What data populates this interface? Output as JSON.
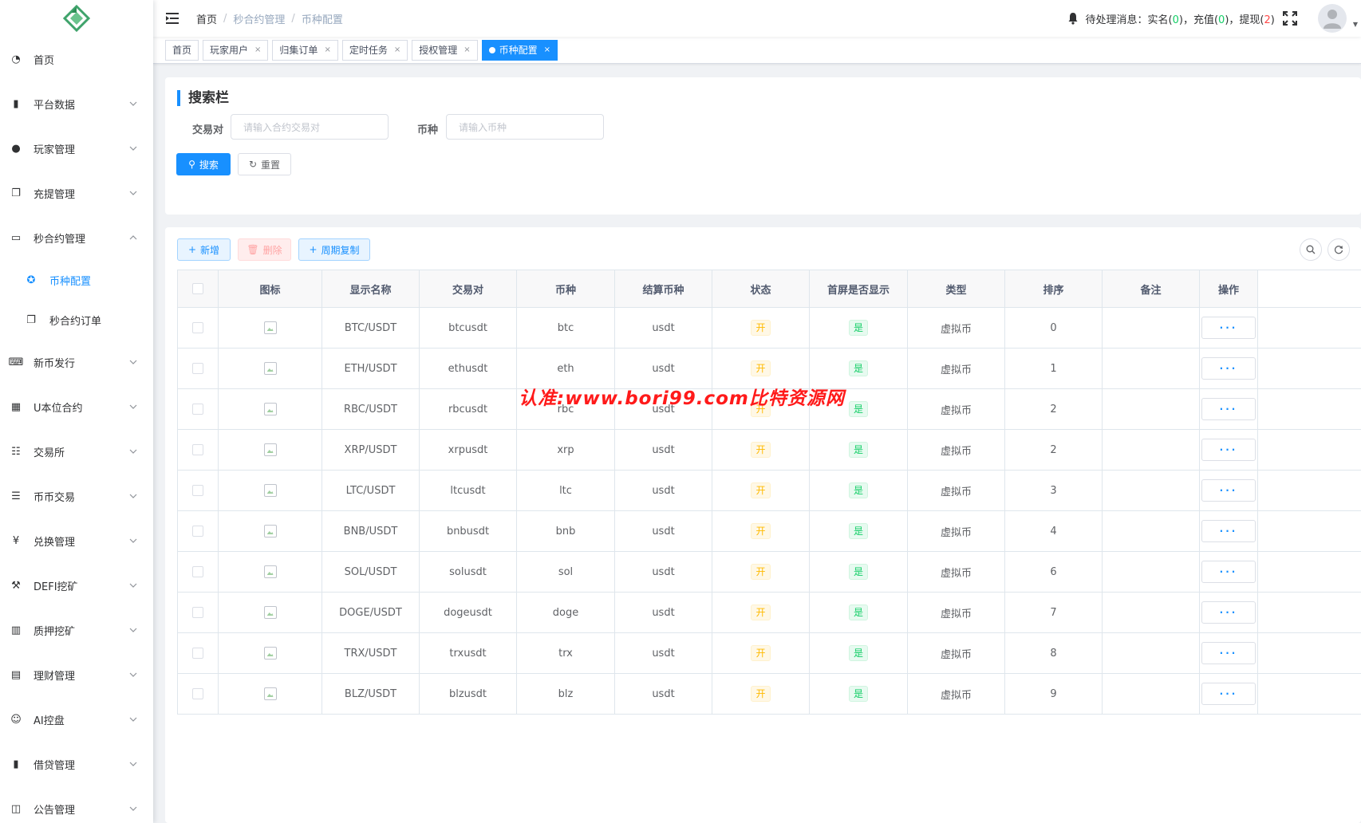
{
  "sidebar": {
    "menu": [
      {
        "label": "首页",
        "icon": "dashboard-icon",
        "arrow": ""
      },
      {
        "label": "平台数据",
        "icon": "book-icon",
        "arrow": "down"
      },
      {
        "label": "玩家管理",
        "icon": "user-icon",
        "arrow": "down"
      },
      {
        "label": "充提管理",
        "icon": "copy-icon",
        "arrow": "down"
      },
      {
        "label": "秒合约管理",
        "icon": "monitor-icon",
        "arrow": "up"
      }
    ],
    "submenu": [
      {
        "label": "币种配置",
        "icon": "gear-icon",
        "active": true
      },
      {
        "label": "秒合约订单",
        "icon": "copy-icon",
        "active": false
      }
    ],
    "menu2": [
      {
        "label": "新币发行",
        "icon": "keyboard-icon"
      },
      {
        "label": "U本位合约",
        "icon": "grid-icon"
      },
      {
        "label": "交易所",
        "icon": "tree-list-icon"
      },
      {
        "label": "币币交易",
        "icon": "list-icon"
      },
      {
        "label": "兑换管理",
        "icon": "yen-icon"
      },
      {
        "label": "DEFI挖矿",
        "icon": "shovel-icon"
      },
      {
        "label": "质押挖矿",
        "icon": "bar-chart-icon"
      },
      {
        "label": "理财管理",
        "icon": "document-icon"
      },
      {
        "label": "AI控盘",
        "icon": "robot-icon"
      },
      {
        "label": "借贷管理",
        "icon": "book-icon"
      },
      {
        "label": "公告管理",
        "icon": "open-book-icon"
      }
    ]
  },
  "navbar": {
    "breadcrumb": [
      "首页",
      "秒合约管理",
      "币种配置"
    ],
    "breadcrumb_sep": "/",
    "notice_prefix": "待处理消息：实名(",
    "notice_realname": "0",
    "notice_mid1": ")，充值(",
    "notice_recharge": "0",
    "notice_mid2": ")，提现(",
    "notice_withdraw": "2",
    "notice_suffix": ")"
  },
  "tags": [
    {
      "label": "首页",
      "closable": false,
      "active": false
    },
    {
      "label": "玩家用户",
      "closable": true,
      "active": false
    },
    {
      "label": "归集订单",
      "closable": true,
      "active": false
    },
    {
      "label": "定时任务",
      "closable": true,
      "active": false
    },
    {
      "label": "授权管理",
      "closable": true,
      "active": false
    },
    {
      "label": "币种配置",
      "closable": true,
      "active": true
    }
  ],
  "search": {
    "title": "搜索栏",
    "pair_label": "交易对",
    "pair_placeholder": "请输入合约交易对",
    "coin_label": "币种",
    "coin_placeholder": "请输入币种",
    "search_button": "搜索",
    "reset_button": "重置"
  },
  "toolbar": {
    "add": "新增",
    "delete": "删除",
    "copy": "周期复制"
  },
  "table": {
    "headers": [
      "图标",
      "显示名称",
      "交易对",
      "币种",
      "结算币种",
      "状态",
      "首屏是否显示",
      "类型",
      "排序",
      "备注",
      "操作"
    ],
    "rows": [
      {
        "name": "BTC/USDT",
        "pair": "btcusdt",
        "coin": "btc",
        "settle": "usdt",
        "status": "开",
        "show": "是",
        "type": "虚拟币",
        "sort": "0",
        "remark": ""
      },
      {
        "name": "ETH/USDT",
        "pair": "ethusdt",
        "coin": "eth",
        "settle": "usdt",
        "status": "开",
        "show": "是",
        "type": "虚拟币",
        "sort": "1",
        "remark": ""
      },
      {
        "name": "RBC/USDT",
        "pair": "rbcusdt",
        "coin": "rbc",
        "settle": "usdt",
        "status": "开",
        "show": "是",
        "type": "虚拟币",
        "sort": "2",
        "remark": ""
      },
      {
        "name": "XRP/USDT",
        "pair": "xrpusdt",
        "coin": "xrp",
        "settle": "usdt",
        "status": "开",
        "show": "是",
        "type": "虚拟币",
        "sort": "2",
        "remark": ""
      },
      {
        "name": "LTC/USDT",
        "pair": "ltcusdt",
        "coin": "ltc",
        "settle": "usdt",
        "status": "开",
        "show": "是",
        "type": "虚拟币",
        "sort": "3",
        "remark": ""
      },
      {
        "name": "BNB/USDT",
        "pair": "bnbusdt",
        "coin": "bnb",
        "settle": "usdt",
        "status": "开",
        "show": "是",
        "type": "虚拟币",
        "sort": "4",
        "remark": ""
      },
      {
        "name": "SOL/USDT",
        "pair": "solusdt",
        "coin": "sol",
        "settle": "usdt",
        "status": "开",
        "show": "是",
        "type": "虚拟币",
        "sort": "6",
        "remark": ""
      },
      {
        "name": "DOGE/USDT",
        "pair": "dogeusdt",
        "coin": "doge",
        "settle": "usdt",
        "status": "开",
        "show": "是",
        "type": "虚拟币",
        "sort": "7",
        "remark": ""
      },
      {
        "name": "TRX/USDT",
        "pair": "trxusdt",
        "coin": "trx",
        "settle": "usdt",
        "status": "开",
        "show": "是",
        "type": "虚拟币",
        "sort": "8",
        "remark": ""
      },
      {
        "name": "BLZ/USDT",
        "pair": "blzusdt",
        "coin": "blz",
        "settle": "usdt",
        "status": "开",
        "show": "是",
        "type": "虚拟币",
        "sort": "9",
        "remark": ""
      }
    ],
    "more_label": "···"
  },
  "watermark": "认准:www.bori99.com比特资源网",
  "colors": {
    "primary": "#1890ff",
    "success": "#13ce66",
    "warning": "#ffba00",
    "danger": "#ff4949"
  }
}
